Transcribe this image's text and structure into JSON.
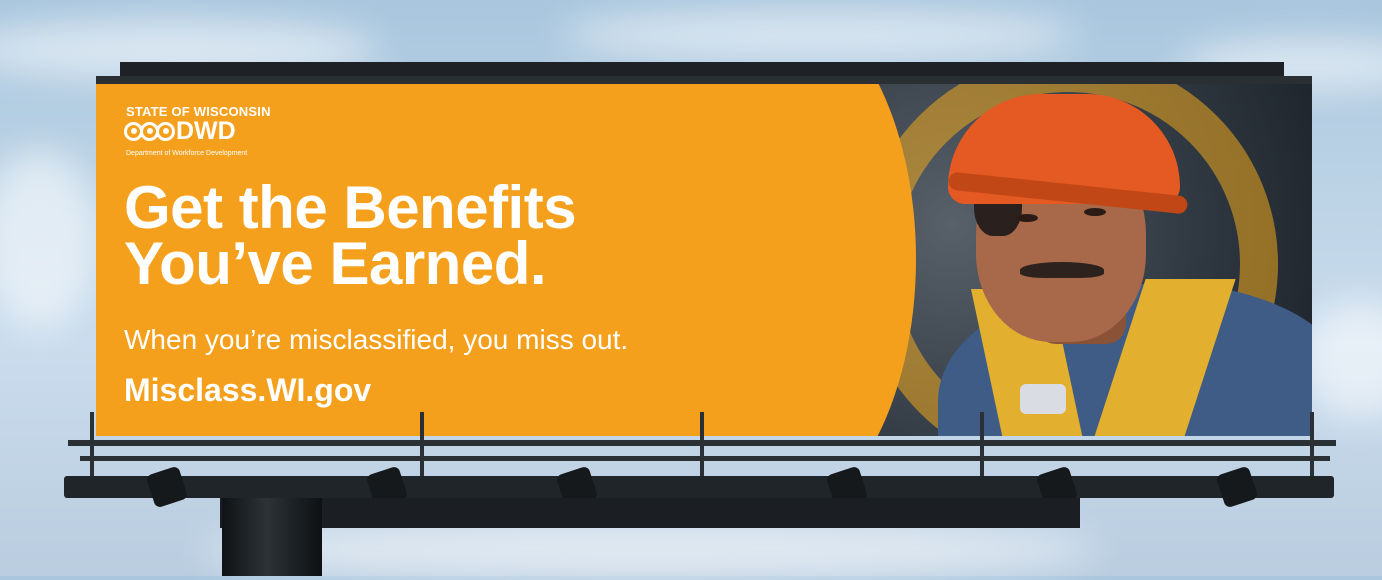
{
  "billboard": {
    "logo": {
      "state_label": "STATE OF WISCONSIN",
      "agency_abbr": "DWD",
      "department": "Department of Workforce Development"
    },
    "headline_line1": "Get the Benefits",
    "headline_line2": "You’ve Earned.",
    "subheadline": "When you’re misclassified, you miss out.",
    "url": "Misclass.WI.gov"
  },
  "colors": {
    "brand_orange": "#f5a01d",
    "text": "#ffffff",
    "hard_hat": "#e45a22",
    "sky": "#bdd4e6"
  },
  "icons": [
    "dwd-logo-icon"
  ]
}
